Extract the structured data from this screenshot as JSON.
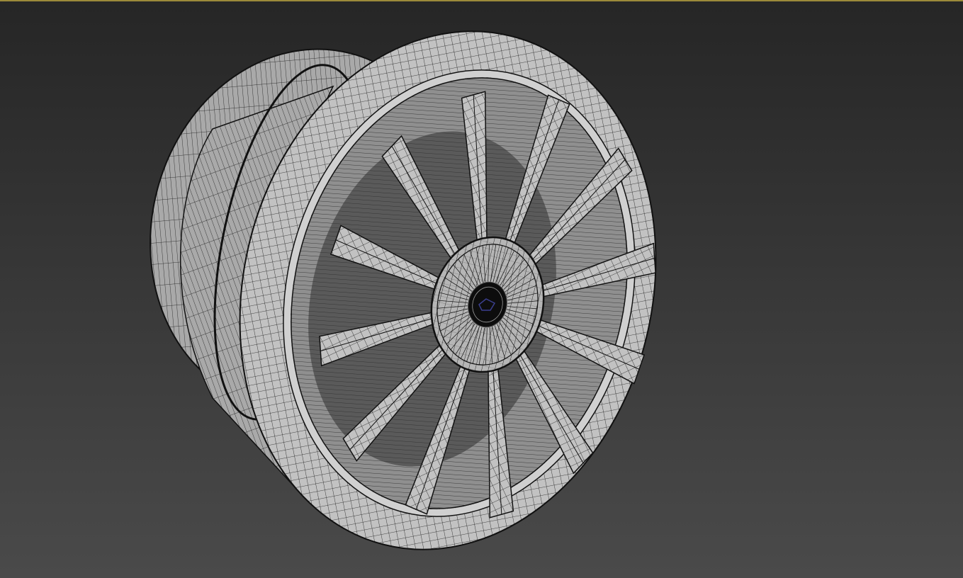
{
  "viewport": {
    "active_border_color": "#9c8a3a",
    "background_top_color": "#262626",
    "background_bottom_color": "#4a4a4a",
    "display_mode": "edged-faces",
    "object": "wheel-rim",
    "spoke_count": 12,
    "mesh_color": "#b4b4b4",
    "edge_color": "#111111",
    "center_cap_color": "#0d0d0d",
    "center_logo_color": "#3b3f8f"
  }
}
